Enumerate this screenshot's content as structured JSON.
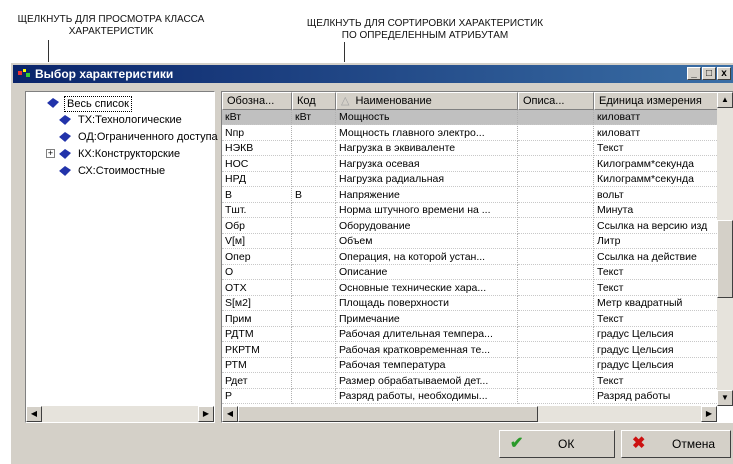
{
  "annotations": {
    "left": "ЩЕЛКНУТЬ ДЛЯ ПРОСМОТРА КЛАССА ХАРАКТЕРИСТИК",
    "right": "ЩЕЛКНУТЬ ДЛЯ СОРТИРОВКИ ХАРАКТЕРИСТИК ПО ОПРЕДЕЛЕННЫМ АТРИБУТАМ"
  },
  "window": {
    "title": "Выбор характеристики",
    "min_glyph": "_",
    "max_glyph": "□",
    "close_glyph": "x"
  },
  "tree": {
    "items": [
      {
        "label": "Весь список",
        "selected": true,
        "expandable": false
      },
      {
        "label": "ТХ:Технологические",
        "selected": false,
        "expandable": false
      },
      {
        "label": "ОД:Ограниченного доступа",
        "selected": false,
        "expandable": false
      },
      {
        "label": "КХ:Конструкторские",
        "selected": false,
        "expandable": true
      },
      {
        "label": "СХ:Стоимостные",
        "selected": false,
        "expandable": false
      }
    ]
  },
  "grid": {
    "headers": [
      "Обозна...",
      "Код",
      "Наименование",
      "Описа...",
      "Единица измерения"
    ],
    "sort_indicator": "△",
    "rows": [
      [
        "кВт",
        "кВт",
        "Мощность",
        "",
        "киловатт"
      ],
      [
        "Nпр",
        "",
        "Мощность главного электро...",
        "",
        "киловатт"
      ],
      [
        "НЭКВ",
        "",
        "Нагрузка в эквиваленте",
        "",
        "Текст"
      ],
      [
        "НОС",
        "",
        "Нагрузка осевая",
        "",
        "Килограмм*секунда"
      ],
      [
        "НРД",
        "",
        "Нагрузка радиальная",
        "",
        "Килограмм*секунда"
      ],
      [
        "В",
        "В",
        "Напряжение",
        "",
        "вольт"
      ],
      [
        "Тшт.",
        "",
        "Норма штучного времени на ...",
        "",
        "Минута"
      ],
      [
        "Обр",
        "",
        "Оборудование",
        "",
        "Ссылка на версию изд"
      ],
      [
        "V[м]",
        "",
        "Объем",
        "",
        "Литр"
      ],
      [
        "Опер",
        "",
        "Операция, на которой устан...",
        "",
        "Ссылка на действие"
      ],
      [
        "О",
        "",
        "Описание",
        "",
        "Текст"
      ],
      [
        "ОТХ",
        "",
        "Основные технические хара...",
        "",
        "Текст"
      ],
      [
        "S[м2]",
        "",
        "Площадь поверхности",
        "",
        "Метр квадратный"
      ],
      [
        "Прим",
        "",
        "Примечание",
        "",
        "Текст"
      ],
      [
        "РДТМ",
        "",
        "Рабочая длительная темпера...",
        "",
        "градус Цельсия"
      ],
      [
        "РКРТМ",
        "",
        "Рабочая кратковременная те...",
        "",
        "градус Цельсия"
      ],
      [
        "РТМ",
        "",
        "Рабочая температура",
        "",
        "градус Цельсия"
      ],
      [
        "Рдет",
        "",
        "Размер обрабатываемой дет...",
        "",
        "Текст"
      ],
      [
        "Р",
        "",
        "Разряд работы, необходимы...",
        "",
        "Разряд работы"
      ]
    ]
  },
  "buttons": {
    "ok_label": "ОК",
    "ok_icon": "✔",
    "cancel_label": "Отмена",
    "cancel_icon": "✖"
  },
  "scroll": {
    "up": "▲",
    "down": "▼",
    "left": "◀",
    "right": "▶"
  },
  "colors": {
    "title_start": "#0a246a",
    "title_end": "#3a6ea5",
    "ok_icon": "#2a9a2a",
    "cancel_icon": "#cc1111",
    "face": "#d4d0c8"
  }
}
